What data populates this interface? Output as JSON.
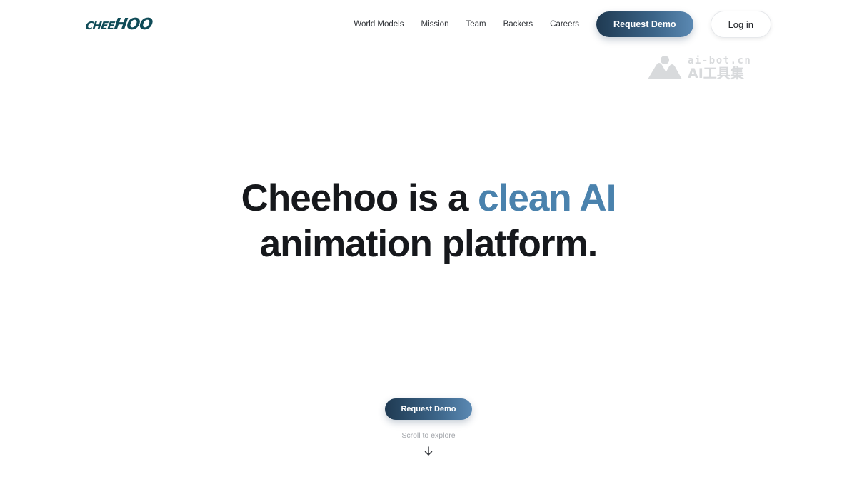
{
  "header": {
    "logo": {
      "small_text": "CHEE",
      "big_text": "HOO",
      "color": "#0f4b57"
    },
    "nav_links": [
      "World Models",
      "Mission",
      "Team",
      "Backers",
      "Careers"
    ],
    "request_demo_label": "Request Demo",
    "login_label": "Log in"
  },
  "watermark": {
    "top": "ai-bot.cn",
    "bottom": "AI工具集"
  },
  "hero": {
    "line1_prefix": "Cheehoo is a ",
    "line1_accent": "clean AI",
    "line2": "animation platform.",
    "accent_color": "#4a82ad"
  },
  "cta": {
    "label": "Request Demo"
  },
  "scroll": {
    "text": "Scroll to explore",
    "icon": "arrow-down-icon"
  },
  "colors": {
    "button_gradient_start": "#1f3a52",
    "button_gradient_end": "#5b89b3",
    "text": "#16181c"
  }
}
